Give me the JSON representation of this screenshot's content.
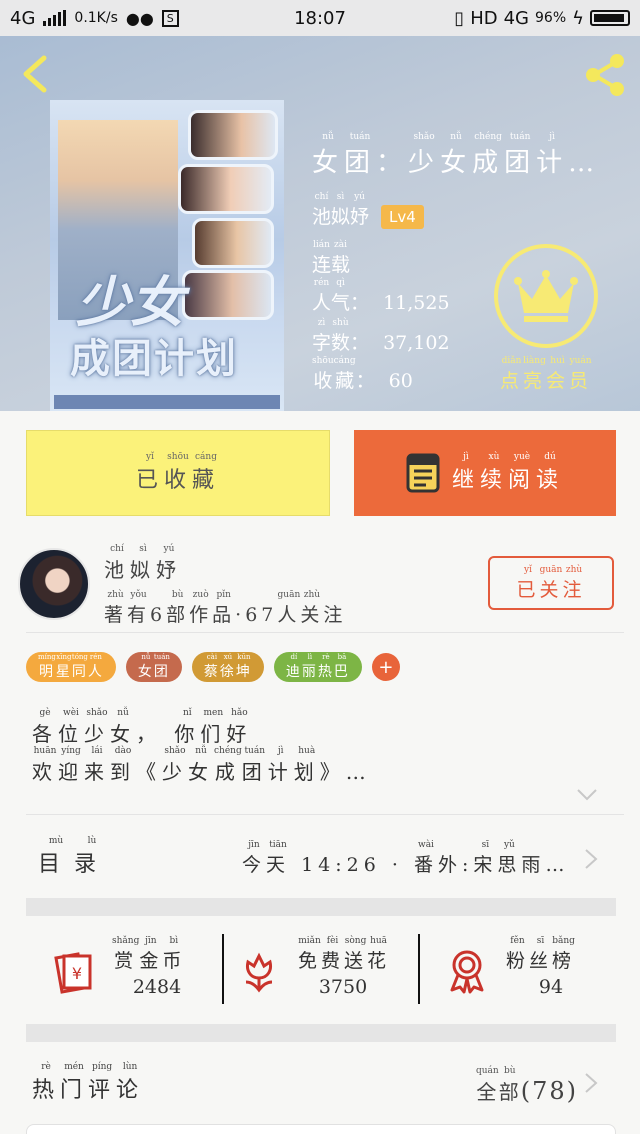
{
  "status_bar": {
    "network": "4G",
    "speed": "0.1K/s",
    "time": "18:07",
    "hd": "HD",
    "network2": "4G",
    "battery": "96%"
  },
  "book": {
    "title": "女团：少女成团计…",
    "title_pinyin": [
      "nǚ",
      "tuán",
      "",
      "shǎo",
      "nǚ",
      "chéng",
      "tuán",
      "jì",
      ""
    ],
    "author": "池姒妤",
    "author_pinyin": [
      "chí",
      "sì",
      "yú"
    ],
    "level": "Lv4",
    "status": "连载",
    "status_pinyin": [
      "lián",
      "zài"
    ],
    "popularity_label": "人气：",
    "popularity_pinyin": [
      "rén",
      "qì"
    ],
    "popularity": "11,525",
    "words_label": "字数：",
    "words_pinyin": [
      "zì",
      "shù"
    ],
    "words": "37,102",
    "collect_label": "收藏：",
    "collect_pinyin": [
      "shōu",
      "cáng"
    ],
    "collect": "60",
    "cover_title_line1": "少女",
    "cover_title_line2": "成团计划"
  },
  "member": {
    "label": "点亮会员",
    "label_pinyin": [
      "diǎn",
      "liàng",
      "huì",
      "yuán"
    ],
    "icon": "crown-icon",
    "color": "#f7ea74"
  },
  "actions": {
    "favorited": "已收藏",
    "favorited_pinyin": [
      "yǐ",
      "shōu",
      "cáng"
    ],
    "continue": "继续阅读",
    "continue_pinyin": [
      "jì",
      "xù",
      "yuè",
      "dú"
    ],
    "fav_color": "#fbf27a",
    "read_color": "#ec6a3b"
  },
  "author_row": {
    "name": "池姒妤",
    "name_pinyin": [
      "chí",
      "sì",
      "yú"
    ],
    "works": "著有6部作品·67人关注",
    "works_pinyin": [
      "zhù",
      "yǒu",
      "",
      "bù",
      "zuò",
      "pǐn",
      "",
      "",
      "rén",
      "guān",
      "zhù"
    ],
    "follow": "已关注",
    "follow_pinyin": [
      "yǐ",
      "guān",
      "zhù"
    ]
  },
  "tags": [
    {
      "label": "明星同人",
      "pinyin": [
        "míng",
        "xīng",
        "tóng",
        "rén"
      ],
      "color": "#f4a93e"
    },
    {
      "label": "女团",
      "pinyin": [
        "nǚ",
        "tuán"
      ],
      "color": "#c56a4d"
    },
    {
      "label": "蔡徐坤",
      "pinyin": [
        "cài",
        "xú",
        "kūn"
      ],
      "color": "#d19a35"
    },
    {
      "label": "迪丽热巴",
      "pinyin": [
        "dí",
        "lì",
        "rè",
        "bā"
      ],
      "color": "#7db545"
    }
  ],
  "synopsis": {
    "line1": "各位少女， 你们好",
    "line1_pinyin": [
      "gè",
      "wèi",
      "shǎo",
      "nǚ",
      "",
      "",
      "nǐ",
      "men",
      "hǎo"
    ],
    "line2": "欢迎来到《少女成团计划》…",
    "line2_pinyin": [
      "huān",
      "yíng",
      "lái",
      "dào",
      "",
      "shǎo",
      "nǚ",
      "chéng",
      "tuán",
      "jì",
      "huà",
      "",
      ""
    ]
  },
  "toc": {
    "label": "目录",
    "label_pinyin": [
      "mù",
      "lù"
    ],
    "latest": "今天 14:26 · 番外:宋思雨…",
    "latest_pinyin": [
      "jīn",
      "tiān",
      "",
      "",
      "",
      "",
      "",
      "",
      "",
      "",
      "fān",
      "wài",
      "",
      "sòng",
      "sī",
      "yǔ",
      ""
    ]
  },
  "stats": [
    {
      "label": "赏金币",
      "pinyin": [
        "shǎng",
        "jīn",
        "bì"
      ],
      "value": "2484",
      "icon": "red-envelope-icon"
    },
    {
      "label": "免费送花",
      "pinyin": [
        "miǎn",
        "fèi",
        "sòng",
        "huā"
      ],
      "value": "3750",
      "icon": "flower-icon"
    },
    {
      "label": "粉丝榜",
      "pinyin": [
        "fěn",
        "sī",
        "bǎng"
      ],
      "value": "94",
      "icon": "medal-icon"
    }
  ],
  "comments": {
    "label": "热门评论",
    "label_pinyin": [
      "rè",
      "mén",
      "píng",
      "lùn"
    ],
    "all": "全部",
    "all_pinyin": [
      "quán",
      "bù"
    ],
    "count": "(78)"
  },
  "icons": {
    "back": "back-arrow-icon",
    "share": "share-icon",
    "accent": "#e35b3c"
  }
}
